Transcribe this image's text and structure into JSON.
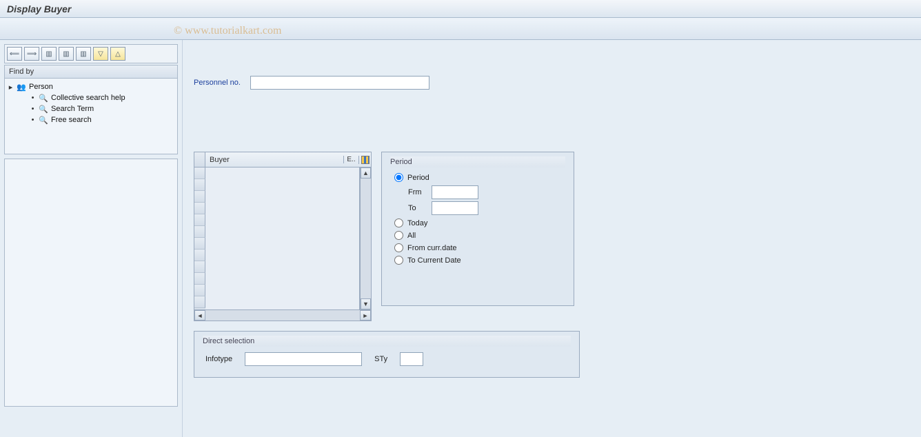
{
  "window": {
    "title": "Display Buyer"
  },
  "watermark": "© www.tutorialkart.com",
  "sidebar": {
    "find_by_label": "Find by",
    "tree": {
      "root": {
        "label": "Person"
      },
      "children": [
        {
          "label": "Collective search help"
        },
        {
          "label": "Search Term"
        },
        {
          "label": "Free search"
        }
      ]
    }
  },
  "form": {
    "personnel_no": {
      "label": "Personnel no.",
      "value": ""
    }
  },
  "table": {
    "column_label": "Buyer",
    "column_e": "E.."
  },
  "period": {
    "title": "Period",
    "options": {
      "period": "Period",
      "today": "Today",
      "all": "All",
      "from_curr": "From curr.date",
      "to_curr": "To Current Date"
    },
    "selected": "period",
    "from": {
      "label": "Frm",
      "value": ""
    },
    "to": {
      "label": "To",
      "value": ""
    }
  },
  "direct": {
    "title": "Direct selection",
    "infotype": {
      "label": "Infotype",
      "value": ""
    },
    "sty": {
      "label": "STy",
      "value": ""
    }
  }
}
